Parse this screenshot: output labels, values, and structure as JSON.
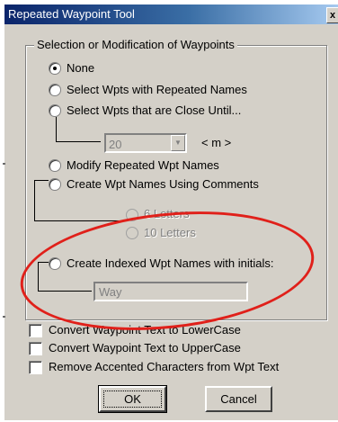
{
  "window": {
    "title": "Repeated Waypoint Tool",
    "close_glyph": "x"
  },
  "selection_group": {
    "legend": "Selection or Modification of Waypoints",
    "options": [
      {
        "label": "None",
        "selected": true,
        "enabled": true
      },
      {
        "label": "Select Wpts with Repeated Names",
        "selected": false,
        "enabled": true
      },
      {
        "label": "Select Wpts that are Close Until...",
        "selected": false,
        "enabled": true
      },
      {
        "label": "Modify Repeated Wpt Names",
        "selected": false,
        "enabled": true
      },
      {
        "label": "Create Wpt Names Using Comments",
        "selected": false,
        "enabled": true
      },
      {
        "label": "6 Letters",
        "selected": false,
        "enabled": false
      },
      {
        "label": "10 Letters",
        "selected": false,
        "enabled": false
      },
      {
        "label": "Create Indexed Wpt Names with initials:",
        "selected": false,
        "enabled": true
      }
    ],
    "distance_combo": {
      "value": "20",
      "unit": "< m >"
    },
    "initials_field": {
      "value": "Way"
    }
  },
  "checkboxes": [
    {
      "label": "Convert Waypoint Text to LowerCase",
      "checked": false
    },
    {
      "label": "Convert Waypoint Text to UpperCase",
      "checked": false
    },
    {
      "label": "Remove Accented Characters from Wpt Text",
      "checked": false
    }
  ],
  "buttons": {
    "ok": "OK",
    "cancel": "Cancel"
  },
  "annotation": {
    "shape": "ellipse",
    "color": "#e0201a"
  },
  "colors": {
    "dialog_bg": "#d4d0c8",
    "title_start": "#0a246a",
    "title_end": "#a6caf0"
  }
}
